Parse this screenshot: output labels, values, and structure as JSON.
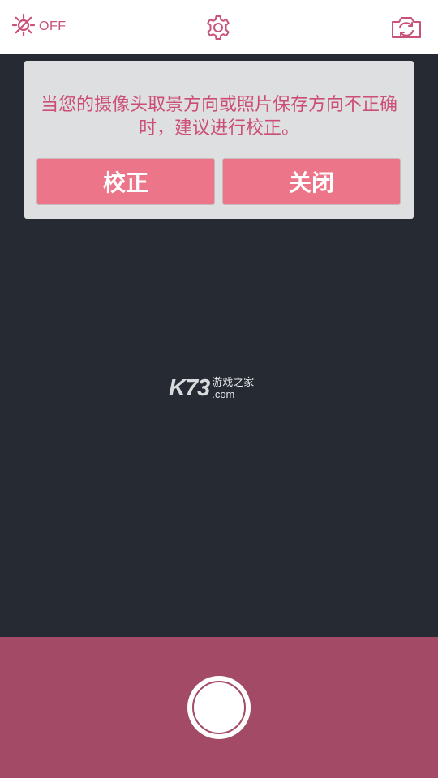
{
  "topbar": {
    "flash_label": "OFF",
    "flash_icon": "flash-off-icon",
    "settings_icon": "gear-icon",
    "camera_switch_icon": "camera-switch-icon"
  },
  "dialog": {
    "message": "当您的摄像头取景方向或照片保存方向不正确时，建议进行校正。",
    "calibrate_label": "校正",
    "close_label": "关闭"
  },
  "watermark": {
    "brand": "K73",
    "subtitle": "游戏之家",
    "domain": ".com"
  },
  "colors": {
    "accent": "#c95279",
    "button": "#ed7589",
    "bottom_bar": "#a24a66",
    "viewfinder": "#252a33",
    "dialog_bg": "#dedfe1"
  }
}
